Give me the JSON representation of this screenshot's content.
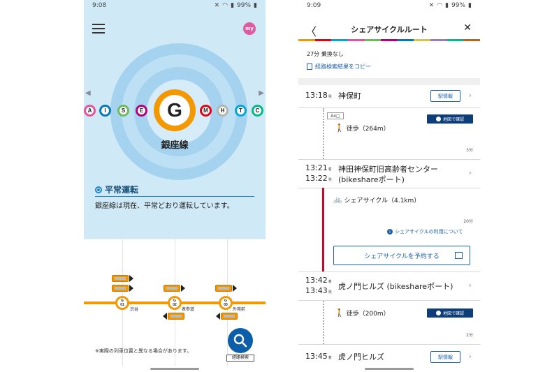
{
  "left": {
    "status": {
      "time": "9:08",
      "battery": "99%"
    },
    "my_badge": "my",
    "line": {
      "letter": "G",
      "name": "銀座線",
      "color": "#f39800"
    },
    "nav": {
      "prev": "◀",
      "next": "▶"
    },
    "lines": [
      {
        "letter": "A",
        "color": "#e85298"
      },
      {
        "letter": "I",
        "color": "#0079c2"
      },
      {
        "letter": "S",
        "color": "#6cbb5a"
      },
      {
        "letter": "E",
        "color": "#b6007a"
      },
      {
        "letter": "M",
        "color": "#e60012"
      },
      {
        "letter": "H",
        "color": "#b5b5ac"
      },
      {
        "letter": "T",
        "color": "#00a7db"
      },
      {
        "letter": "C",
        "color": "#00bb85"
      }
    ],
    "operation": {
      "title": "平常運転",
      "desc": "銀座線は現在、平常どおり運転しています。"
    },
    "stations": [
      {
        "code": "G\n01",
        "name": "渋谷"
      },
      {
        "code": "G\n02",
        "name": "表参道"
      },
      {
        "code": "G\n03",
        "name": "外苑前"
      }
    ],
    "note": "※実際の列車位置と異なる場合があります。",
    "search_label": "経路検索"
  },
  "right": {
    "status": {
      "time": "9:09",
      "battery": "99%"
    },
    "header": {
      "title": "シェアサイクルルート",
      "back": "〈",
      "close": "✕"
    },
    "strip_colors": [
      "#f39800",
      "#e60012",
      "#00a7db",
      "#e85298",
      "#6cbb5a",
      "#b6007a",
      "#0079c2",
      "#d7c447",
      "#9b7cb6",
      "#00bb85",
      "#bb641d"
    ],
    "summary": "27分  乗換なし",
    "copy_label": "経路検索結果をコピー",
    "stops": [
      {
        "time": "13:18",
        "suffix": "発",
        "name": "神保町",
        "button": "駅情報"
      },
      {
        "time1": "13:21",
        "suffix1": "着",
        "time2": "13:22",
        "suffix2": "発",
        "name1": "神田神保町旧高齢者センター",
        "name2": "(bikeshareポート)"
      },
      {
        "time1": "13:42",
        "suffix1": "着",
        "time2": "13:43",
        "suffix2": "発",
        "name": "虎ノ門ヒルズ (bikeshareポート)"
      },
      {
        "time": "13:45",
        "suffix": "着",
        "name": "虎ノ門ヒルズ",
        "button": "駅情報"
      }
    ],
    "walk1": {
      "exit": "A4□",
      "label": "徒歩（264m）",
      "map": "地図で確認",
      "mins": "3分"
    },
    "bike": {
      "label": "シェアサイクル（4.1km）",
      "mins": "20分",
      "info": "シェアサイクルの利用について",
      "reserve": "シェアサイクルを予約する"
    },
    "walk2": {
      "label": "徒歩（200m）",
      "map": "地図で確認",
      "mins": "2分"
    }
  }
}
